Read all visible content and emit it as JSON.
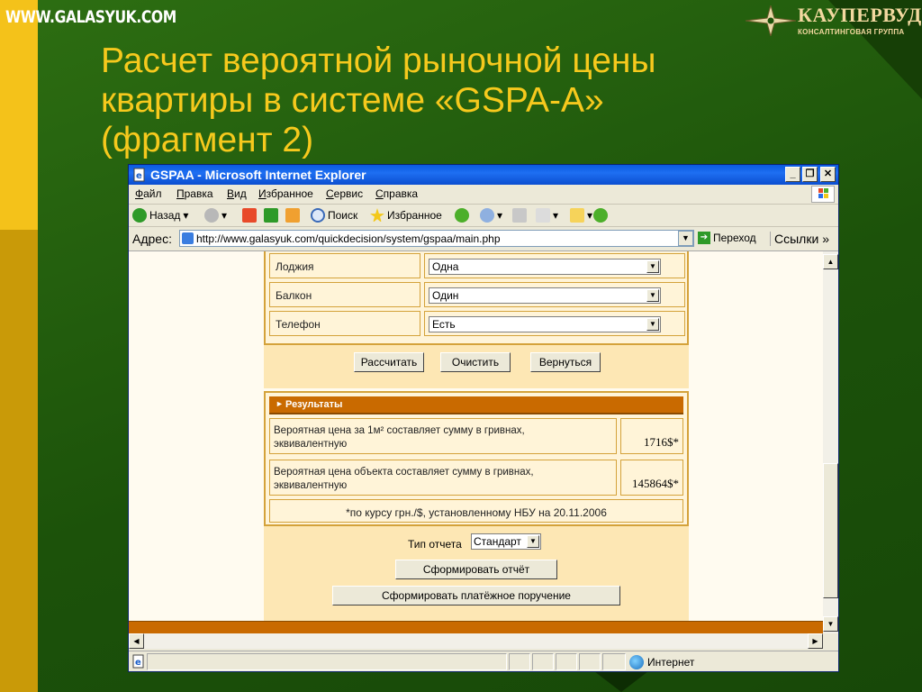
{
  "site": {
    "url_text": "WWW.GALASYUK.COM"
  },
  "logo": {
    "title": "КАУПЕРВУД",
    "subtitle": "КОНСАЛТИНГОВАЯ ГРУППА"
  },
  "slide": {
    "title_line1": "Расчет вероятной рыночной цены",
    "title_line2": "квартиры в системе «GSPA-A»",
    "title_line3": "(фрагмент 2)"
  },
  "window": {
    "title": "GSPAA - Microsoft Internet Explorer",
    "minimize": "_",
    "restore": "❐",
    "close": "✕"
  },
  "menu": [
    {
      "key": "Ф",
      "rest": "айл"
    },
    {
      "key": "П",
      "rest": "равка"
    },
    {
      "key": "В",
      "rest": "ид"
    },
    {
      "key": "И",
      "rest": "збранное"
    },
    {
      "key": "С",
      "rest": "ервис"
    },
    {
      "key": "С",
      "rest": "правка"
    }
  ],
  "toolbar": {
    "back": "Назад",
    "search": "Поиск",
    "favorites": "Избранное"
  },
  "address": {
    "label": "Адрес:",
    "url": "http://www.galasyuk.com/quickdecision/system/gspaa/main.php",
    "go": "Переход",
    "links": "Ссылки",
    "links_more": "»"
  },
  "form": {
    "rows": [
      {
        "label": "Лоджия",
        "value": "Одна"
      },
      {
        "label": "Балкон",
        "value": "Один"
      },
      {
        "label": "Телефон",
        "value": "Есть"
      }
    ],
    "buttons": {
      "calculate": "Рассчитать",
      "clear": "Очистить",
      "back": "Вернуться"
    }
  },
  "results": {
    "header": "Результаты",
    "rows": [
      {
        "label_line1": "Вероятная цена за 1м² составляет сумму в гривнах,",
        "label_line2": "эквивалентную",
        "value": "1716$*"
      },
      {
        "label_line1": "Вероятная цена объекта составляет сумму в гривнах,",
        "label_line2": "эквивалентную",
        "value": "145864$*"
      }
    ],
    "note": "*по курсу грн./$, установленному НБУ на 20.11.2006"
  },
  "report": {
    "type_label": "Тип отчета",
    "type_value": "Стандарт",
    "generate_report": "Сформировать отчёт",
    "generate_payment": "Сформировать платёжное поручение"
  },
  "status": {
    "zone": "Интернет"
  },
  "colors": {
    "title_yellow": "#f6c91d",
    "xp_blue": "#0a5ae0",
    "result_orange": "#c96a00",
    "panel_border": "#d4a23a"
  }
}
